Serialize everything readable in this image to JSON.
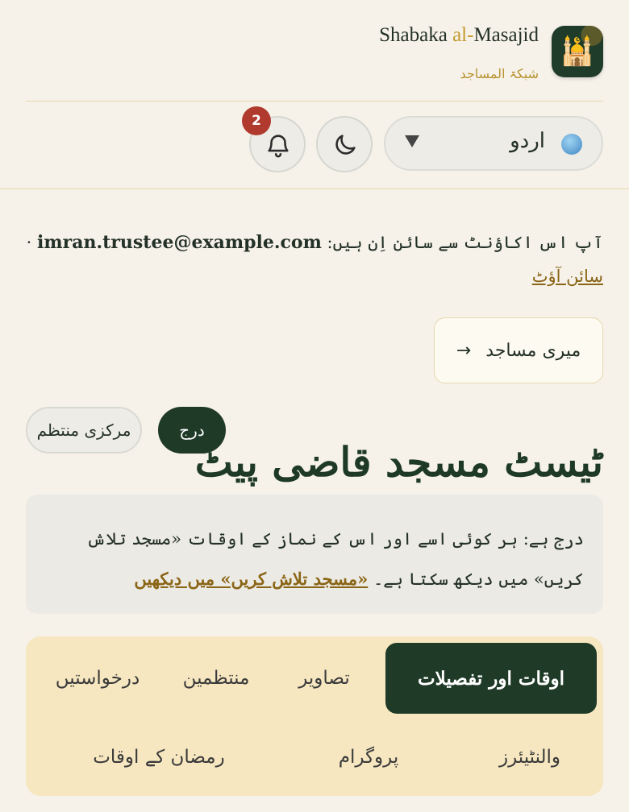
{
  "brand": {
    "name_prefix": "Shabaka ",
    "name_accent": "al-",
    "name_suffix": "Masajid",
    "subtitle": "شبکۃ المساجد",
    "logo_icon": "mosque-icon"
  },
  "toolbar": {
    "language": "اردو",
    "notifications_count": "2",
    "language_icon": "globe-icon",
    "theme_icon": "moon-icon",
    "notification_icon": "bell-icon"
  },
  "account": {
    "signed_in_text": "آپ اس اکاؤنٹ سے سائن اِن ہیں:",
    "email": "imran.trustee@example.com",
    "separator": "·",
    "sign_out": "سائن آؤٹ"
  },
  "nav": {
    "my_masjids": "میری مساجد",
    "arrow": "→"
  },
  "masjid": {
    "title": "ٹیسٹ مسجد قاضی پیٹ",
    "status_badge": "درج",
    "role_badge": "مرکزی منتظم"
  },
  "notice": {
    "text": "درج ہے: ہر کوئی اسے اور اس کے نماز کے اوقات «مسجد تلاش کریں» میں دیکھ سکتا ہے۔",
    "link": "«مسجد تلاش کریں» میں دیکھیں"
  },
  "tabs": [
    "اوقات اور تفصیلات",
    "تصاویر",
    "منتظمین",
    "درخواستیں",
    "والنٹیئرز",
    "پروگرام",
    "رمضان کے اوقات"
  ],
  "colors": {
    "primary": "#1f3a27",
    "accent": "#c49a2c",
    "link": "#8a6516",
    "badge": "#b03a2e",
    "background": "#f6f2ea",
    "tabs_bg": "#f6e7c1"
  }
}
